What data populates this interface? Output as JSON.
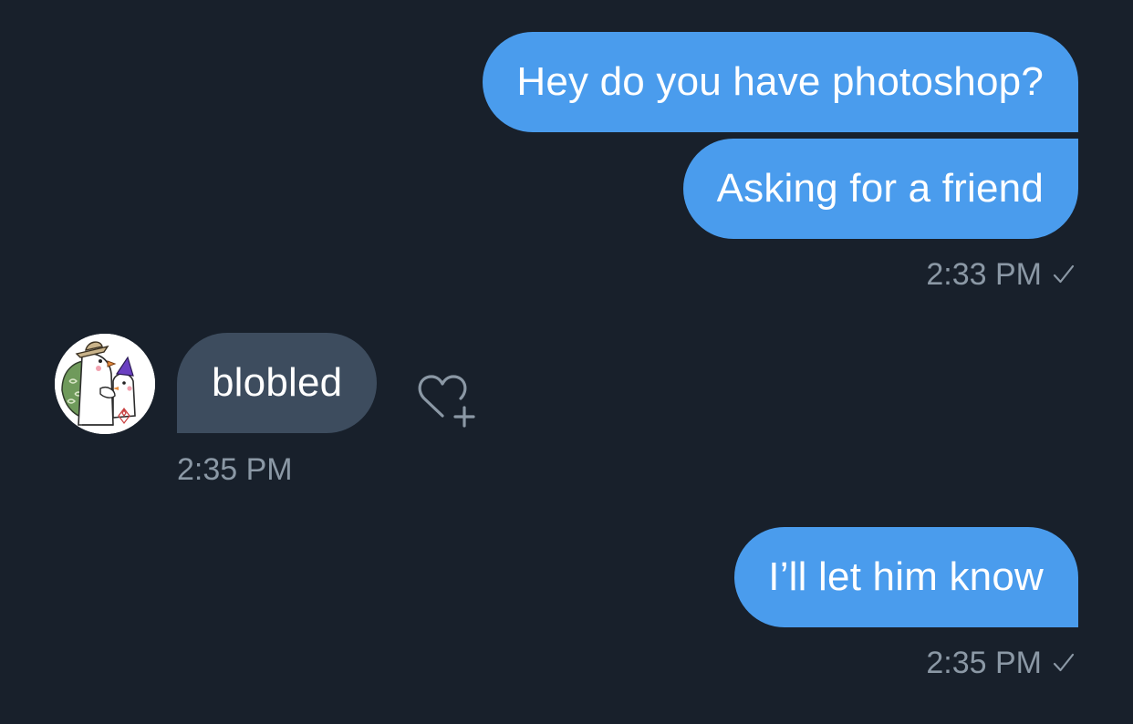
{
  "conversation": {
    "messages": [
      {
        "direction": "outgoing",
        "text": "Hey do you have photoshop?"
      },
      {
        "direction": "outgoing",
        "text": "Asking for a friend"
      },
      {
        "direction": "incoming",
        "text": "blobled"
      },
      {
        "direction": "outgoing",
        "text": "I’ll let him know"
      }
    ],
    "timestamps": {
      "group1": "2:33 PM",
      "incoming": "2:35 PM",
      "group2": "2:35 PM"
    },
    "icons": {
      "read_receipt": "check-icon",
      "react": "heart-plus-icon",
      "avatar": "user-avatar"
    },
    "colors": {
      "background": "#18202b",
      "outgoing_bubble": "#4a9ced",
      "incoming_bubble": "#3d4c5e",
      "meta_text": "#8b98a5"
    }
  }
}
